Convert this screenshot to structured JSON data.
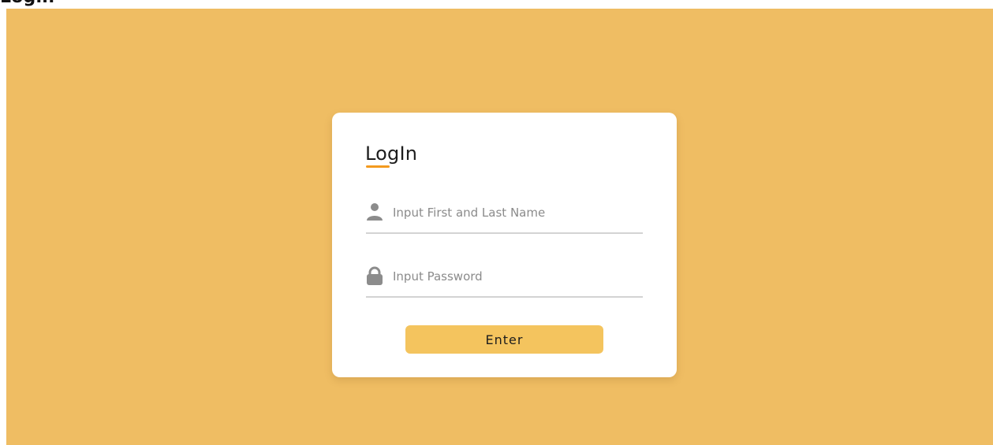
{
  "page": {
    "title": "Login",
    "background_color": "#efbd63"
  },
  "card": {
    "title": "LogIn",
    "accent_color": "#f39a1e"
  },
  "form": {
    "name_field": {
      "icon": "user-icon",
      "placeholder": "Input First and Last Name",
      "value": ""
    },
    "password_field": {
      "icon": "lock-icon",
      "placeholder": "Input Password",
      "value": ""
    },
    "submit": {
      "label": "Enter",
      "color": "#f4c45e"
    }
  }
}
